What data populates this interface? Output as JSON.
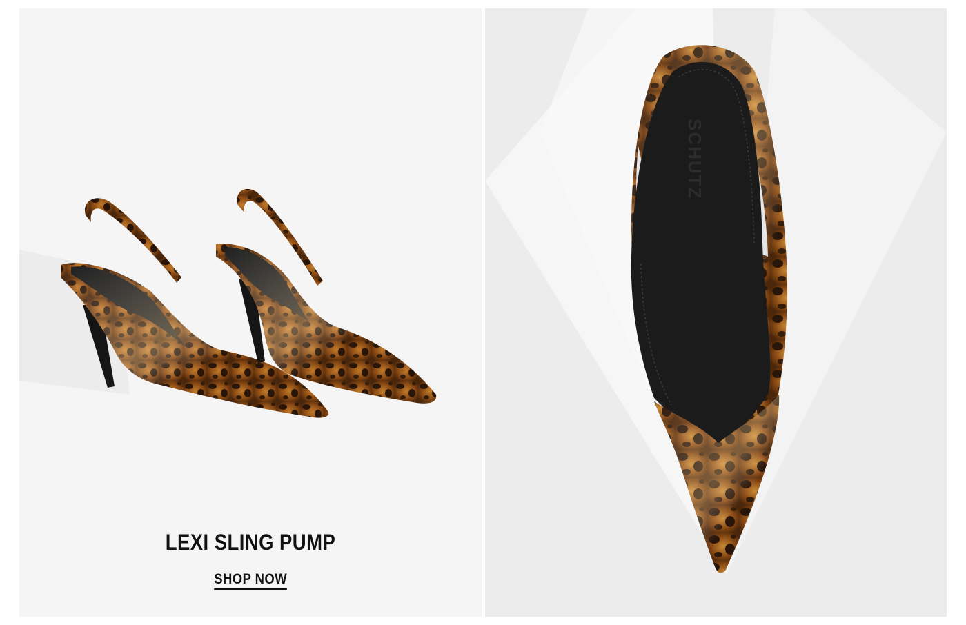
{
  "product": {
    "title": "LEXI SLING PUMP",
    "cta_label": "SHOP NOW",
    "insole_brand": "SCHUTZ"
  },
  "images": {
    "left_alt": "two-leopard-slingback-pumps",
    "right_alt": "top-down-leopard-pump"
  },
  "colors": {
    "leopard_base": "#8a4a14",
    "leopard_spot": "#2a1608",
    "lining": "#1b1b1b",
    "left_background": "#f5f5f5",
    "right_background": "#ececec",
    "text": "#111111"
  }
}
